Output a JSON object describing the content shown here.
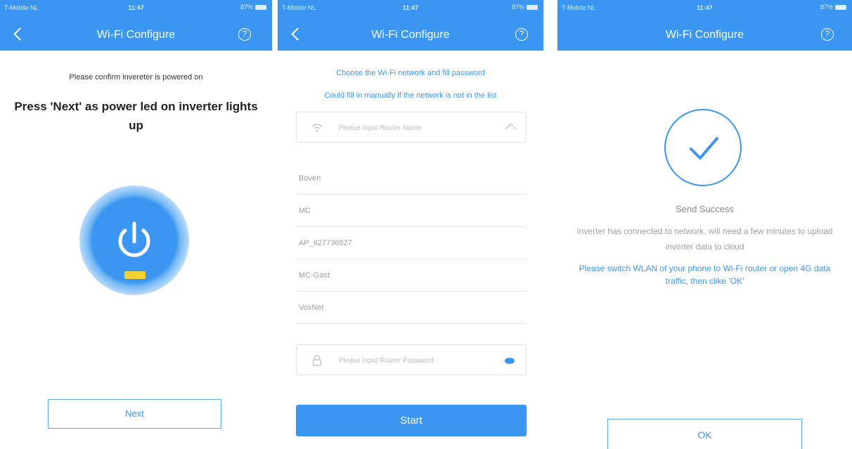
{
  "status_bar": {
    "carrier": "T-Mobile NL",
    "time": "11:47",
    "battery": "87%"
  },
  "screens": {
    "confirm": {
      "title": "Wi-Fi Configure",
      "confirm_text": "Please confirm invereter is powered on",
      "press_text": "Press 'Next' as power led on inverter lights up",
      "next_label": "Next"
    },
    "select_network": {
      "title": "Wi-Fi Configure",
      "info_line_1": "Choose the Wi-Fi network and fill password",
      "info_line_2": "Could fill in manually if the network is not in the list",
      "router_name_placeholder": "Please Input Router Name",
      "networks": [
        "Boven",
        "MC",
        "AP_627736827",
        "MC-Gast",
        "VoxNet"
      ],
      "password_placeholder": "Please Input Router Password",
      "start_label": "Start"
    },
    "success": {
      "title": "Wi-Fi Configure",
      "success_title": "Send Success",
      "success_desc": "Inverter has connected to network, will need a few minutes to upload inverter data to cloud",
      "switch_text": "Please switch WLAN of your phone to Wi-Fi router or open 4G data traffic, then clike 'OK'",
      "ok_label": "OK"
    }
  },
  "colors": {
    "accent": "#3a96f0",
    "led": "#f3d232"
  },
  "icons": [
    "back-icon",
    "help-icon",
    "power-icon",
    "wifi-icon",
    "chevron-up-icon",
    "lock-icon",
    "eye-icon",
    "checkmark-icon"
  ]
}
